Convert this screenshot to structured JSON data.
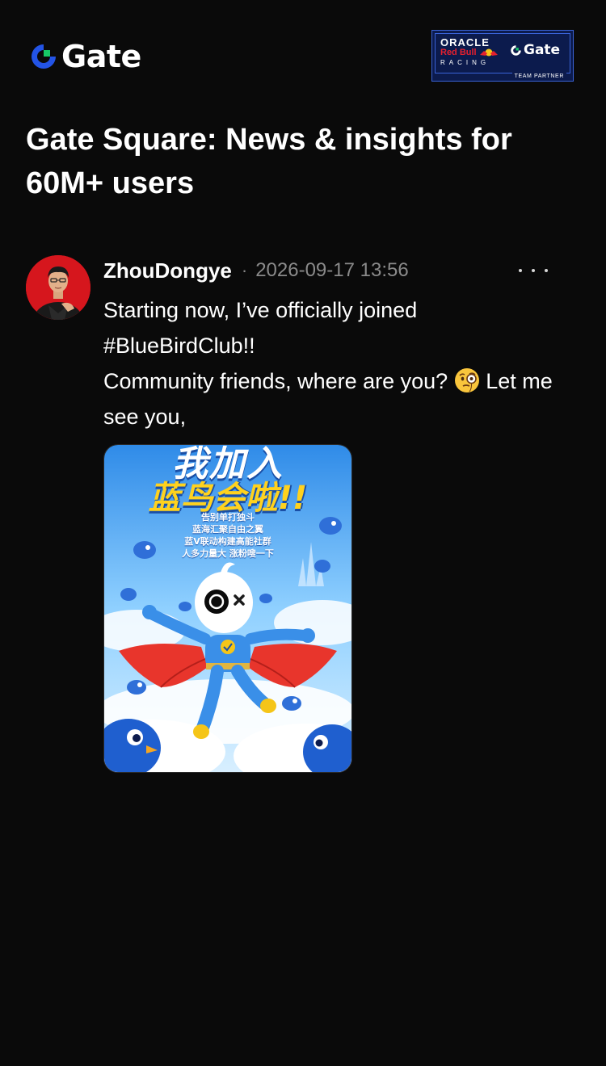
{
  "brand": {
    "name": "Gate",
    "accent": "#2354e6",
    "accent_secondary": "#17c967"
  },
  "partner": {
    "oracle": "ORACLE",
    "redbull": "Red Bull",
    "racing": "RACING",
    "gate": "Gate",
    "team_partner": "TEAM PARTNER"
  },
  "hero": {
    "title": "Gate Square: News & insights for 60M+ users"
  },
  "post": {
    "author": "ZhouDongye",
    "separator": "·",
    "timestamp": "2026-09-17 13:56",
    "more_icon": "more-icon",
    "lines": [
      "Starting now, I’ve officially joined",
      "#BlueBirdClub!!",
      "Community friends, where are you?",
      "Let me see you,"
    ],
    "emoji": "face-with-monocle",
    "image": {
      "headline_1": "我加入",
      "headline_2": "蓝鸟会啦!!",
      "sublines": [
        "告别单打独斗",
        "蓝海汇聚自由之翼",
        "蓝V联动构建高能社群",
        "人多力量大 涨粉嗖一下"
      ]
    }
  }
}
